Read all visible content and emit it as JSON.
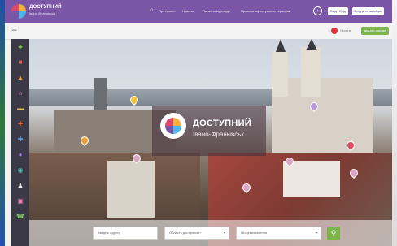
{
  "header": {
    "brand_name": "ДОСТУПНИЙ",
    "brand_city": "Івано-Франківськ",
    "home_icon": "home-icon",
    "nav": [
      "Про проект",
      "Новини",
      "Питання відповідь",
      "Правила користування сервісом"
    ],
    "buttons": {
      "login": "Вхід / Вхід",
      "register": "Вхід для закладів"
    }
  },
  "subbar": {
    "flag_label": "Ukraine",
    "add_button": "додати заклад"
  },
  "sidebar": {
    "icons": [
      "tree-icon",
      "bus-icon",
      "cart-icon",
      "house-icon",
      "bed-icon",
      "fork-knife-icon",
      "medical-icon",
      "car-icon",
      "globe-icon",
      "person-icon",
      "bank-icon",
      "phone-icon"
    ]
  },
  "hero": {
    "title": "ДОСТУПНИЙ",
    "subtitle": "Івано-Франківськ"
  },
  "search": {
    "address_placeholder": "Введіть адресу",
    "accessibility_placeholder": "Область доступності",
    "category_placeholder": "Місцевизначення"
  },
  "colors": {
    "brand": "#7b55a6",
    "accent": "#7bb54b",
    "flag": "#e0353d"
  }
}
